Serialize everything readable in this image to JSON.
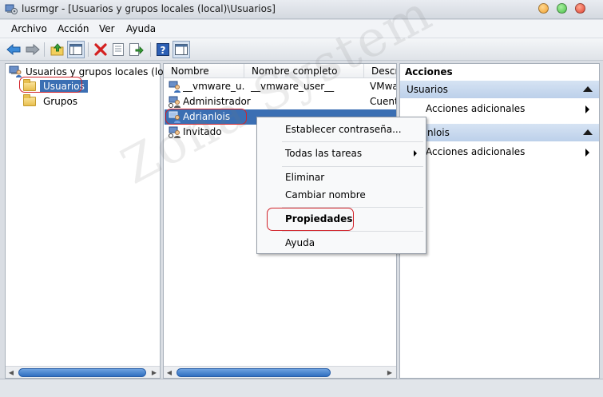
{
  "window": {
    "title": "lusrmgr - [Usuarios y grupos locales (local)\\Usuarios]"
  },
  "window_controls": {
    "minimize_color": "#f0a030",
    "maximize_color": "#48c048",
    "close_color": "#e04030"
  },
  "menu": {
    "items": [
      "Archivo",
      "Acción",
      "Ver",
      "Ayuda"
    ]
  },
  "toolbar": {
    "buttons": [
      "back-icon",
      "forward-icon",
      "up-folder-icon",
      "show-hide-tree-icon",
      "delete-icon",
      "properties-icon",
      "export-list-icon",
      "help-icon",
      "show-hide-action-pane-icon"
    ]
  },
  "tree": {
    "root": "Usuarios y grupos locales (local)",
    "children": [
      "Usuarios",
      "Grupos"
    ],
    "selected": "Usuarios"
  },
  "list": {
    "columns": [
      "Nombre",
      "Nombre completo",
      "Descr"
    ],
    "rows": [
      {
        "name": "__vmware_u...",
        "full_name": "__vmware_user__",
        "description": "VMwa"
      },
      {
        "name": "Administrador",
        "full_name": "",
        "description": "Cuent"
      },
      {
        "name": "Adrianlois",
        "full_name": "",
        "description": ""
      },
      {
        "name": "Invitado",
        "full_name": "",
        "description": ""
      }
    ],
    "selected": "Adrianlois",
    "selection_color": "#3b6fb3"
  },
  "actions_pane": {
    "title": "Acciones",
    "sections": [
      {
        "header": "Usuarios",
        "item": "Acciones adicionales"
      },
      {
        "header": "nlois",
        "item": "Acciones adicionales"
      }
    ]
  },
  "context_menu": {
    "items": [
      "Establecer contraseña...",
      "Todas las tareas",
      "Eliminar",
      "Cambiar nombre",
      "Propiedades",
      "Ayuda"
    ]
  },
  "watermark": {
    "text": "Zona System"
  },
  "annotation_color": "#d2232a"
}
